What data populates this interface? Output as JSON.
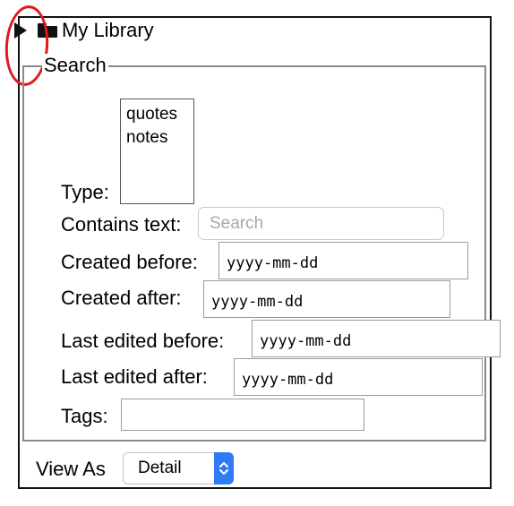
{
  "library": {
    "title": "My Library"
  },
  "search": {
    "legend": "Search",
    "type_label": "Type:",
    "type_options": [
      "quotes",
      "notes"
    ],
    "contains_text_label": "Contains text:",
    "contains_text_placeholder": "Search",
    "created_before_label": "Created before:",
    "created_before_value": "yyyy-mm-dd",
    "created_after_label": "Created after:",
    "created_after_value": "yyyy-mm-dd",
    "last_edited_before_label": "Last edited before:",
    "last_edited_before_value": "yyyy-mm-dd",
    "last_edited_after_label": "Last edited after:",
    "last_edited_after_value": "yyyy-mm-dd",
    "tags_label": "Tags:",
    "tags_value": ""
  },
  "view": {
    "label": "View As",
    "selected": "Detail"
  },
  "colors": {
    "highlight": "#e01919",
    "select_accent": "#2f7bf5"
  }
}
